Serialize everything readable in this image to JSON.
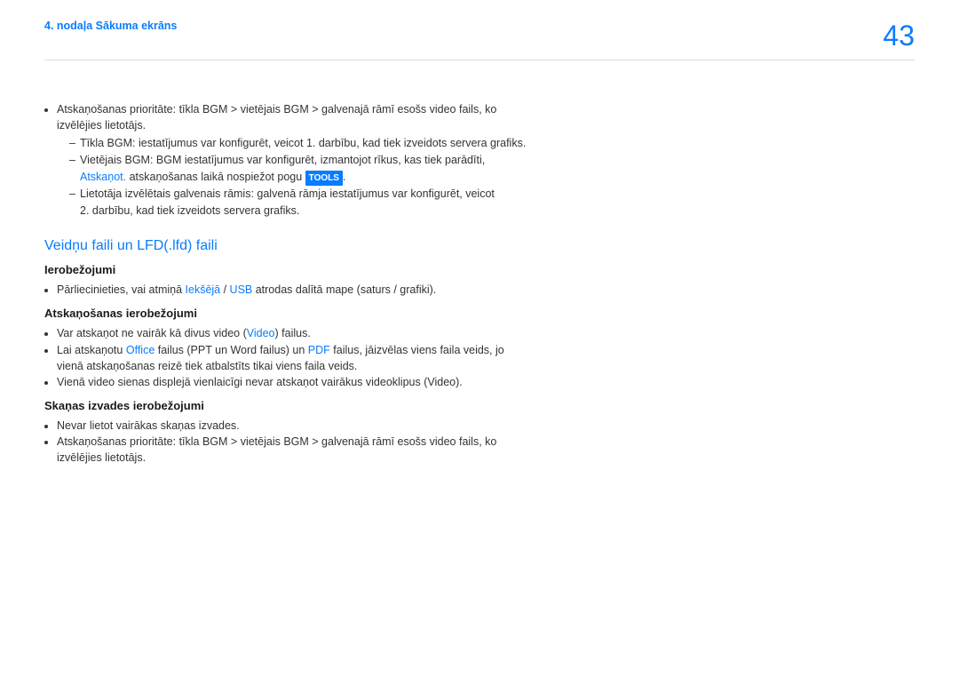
{
  "header": {
    "breadcrumb": "4. nodaļa Sākuma ekrāns",
    "page_number": "43"
  },
  "intro": {
    "bullet1_a": "Atskaņošanas prioritāte: tīkla BGM > vietējais BGM > galvenajā rāmī esošs video fails, ko",
    "bullet1_b": "izvēlējies lietotājs.",
    "dash1": "Tīkla BGM: iestatījumus var konfigurēt, veicot 1. darbību, kad tiek izveidots servera grafiks.",
    "dash2_a": "Vietējais BGM: BGM iestatījumus var konfigurēt, izmantojot rīkus, kas tiek parādīti,",
    "dash2_b_prefix": "Atskaņot.",
    "dash2_b_mid": " atskaņošanas laikā nospiežot pogu ",
    "dash2_b_badge": "TOOLS",
    "dash2_b_suffix": ".",
    "dash3_a": "Lietotāja izvēlētais galvenais rāmis: galvenā rāmja iestatījumus var konfigurēt, veicot",
    "dash3_b": "2. darbību, kad tiek izveidots servera grafiks."
  },
  "section": {
    "title": "Veidņu faili un LFD(.lfd) faili",
    "sub1": {
      "heading": "Ierobežojumi",
      "bullet1_a": "Pārliecinieties, vai atmiņā ",
      "bullet1_hl1": "Iekšējā",
      "bullet1_sep": " / ",
      "bullet1_hl2": "USB",
      "bullet1_b": " atrodas dalītā mape (saturs / grafiki)."
    },
    "sub2": {
      "heading": "Atskaņošanas ierobežojumi",
      "bullet1_a": "Var atskaņot ne vairāk kā divus video (",
      "bullet1_hl": "Video",
      "bullet1_b": ") failus.",
      "bullet2_a": "Lai atskaņotu ",
      "bullet2_hl1": "Office",
      "bullet2_b": " failus (PPT un Word failus) un ",
      "bullet2_hl2": "PDF",
      "bullet2_c": " failus, jāizvēlas viens faila veids, jo",
      "bullet2_d": "vienā atskaņošanas reizē tiek atbalstīts tikai viens faila veids.",
      "bullet3": "Vienā video sienas displejā vienlaicīgi nevar atskaņot vairākus videoklipus (Video)."
    },
    "sub3": {
      "heading": "Skaņas izvades ierobežojumi",
      "bullet1": "Nevar lietot vairākas skaņas izvades.",
      "bullet2_a": "Atskaņošanas prioritāte: tīkla BGM > vietējais BGM > galvenajā rāmī esošs video fails, ko",
      "bullet2_b": "izvēlējies lietotājs."
    }
  }
}
